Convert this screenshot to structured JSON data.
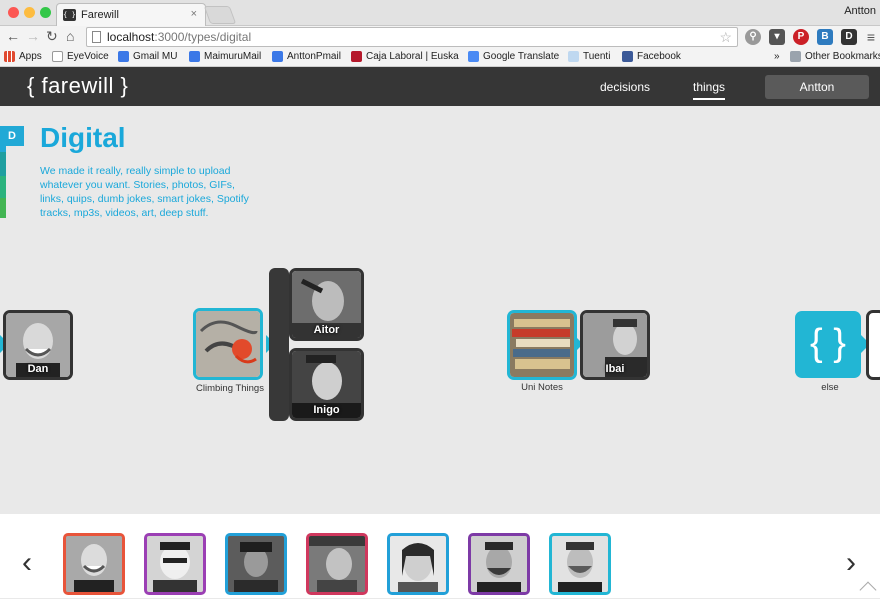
{
  "browser": {
    "tab_title": "Farewill",
    "tab_favicon": "{ }",
    "tab_close": "×",
    "profile_name": "Antton",
    "url_host": "localhost",
    "url_path": ":3000/types/digital"
  },
  "bookmarks": [
    {
      "label": "Apps",
      "color": "#e0492f"
    },
    {
      "label": "EyeVoice",
      "color": "#ffffff"
    },
    {
      "label": "Gmail MU",
      "color": "#3b78e7"
    },
    {
      "label": "MaimuruMail",
      "color": "#3b78e7"
    },
    {
      "label": "AnttonPmail",
      "color": "#3b78e7"
    },
    {
      "label": "Caja Laboral | Euska",
      "color": "#b5182b"
    },
    {
      "label": "Google Translate",
      "color": "#4a8af4"
    },
    {
      "label": "Tuenti",
      "color": "#bfd8f0"
    },
    {
      "label": "Facebook",
      "color": "#3b5998"
    }
  ],
  "bookmarks_overflow": "»",
  "bookmarks_other": "Other Bookmarks",
  "app": {
    "logo": "{ farewill }",
    "nav": [
      {
        "label": "decisions",
        "active": false
      },
      {
        "label": "things",
        "active": true
      }
    ],
    "user_button": "Antton"
  },
  "type": {
    "badge": "D",
    "title": "Digital",
    "description": "We made it really, really simple to upload whatever you want. Stories, photos, GIFs, links, quips, dumb jokes, smart jokes, Spotify tracks, mp3s, videos, art, deep stuff.",
    "accent": "#1aa8da"
  },
  "cards": {
    "dan": "Dan",
    "climbing_label": "Climbing Things",
    "aitor": "Aitor",
    "inigo": "Inigo",
    "uninotes_label": "Uni Notes",
    "ibai": "Ibai",
    "else_label": "else",
    "else_icon": "{ }"
  },
  "bottom": {
    "prev": "‹",
    "next": "›",
    "thumb_colors": [
      "#e8543a",
      "#9b3fb4",
      "#22a0d8",
      "#d0385e",
      "#22a0d8",
      "#7d3aa6",
      "#22b6d4"
    ]
  }
}
